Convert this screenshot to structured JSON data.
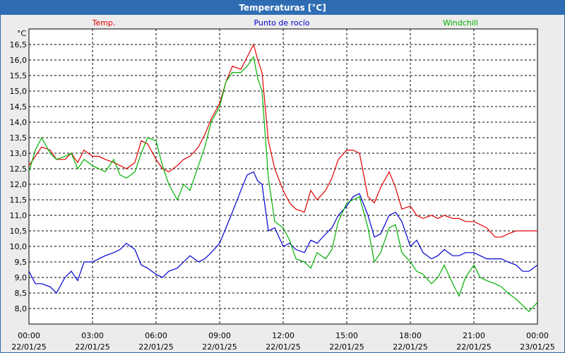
{
  "window": {
    "title": "Temperaturas [°C]"
  },
  "chart_data": {
    "type": "line",
    "title": "Temperaturas [°C]",
    "ylabel": "°C",
    "xlabel": "",
    "x_unit": "hours since 22/01/25 00:00",
    "ylim": [
      7.5,
      17.0
    ],
    "xlim": [
      0,
      24
    ],
    "grid": true,
    "legend_position": "top",
    "yticks": [
      "8,0",
      "8,5",
      "9,0",
      "9,5",
      "10,0",
      "10,5",
      "11,0",
      "11,5",
      "12,0",
      "12,5",
      "13,0",
      "13,5",
      "14,0",
      "14,5",
      "15,0",
      "15,5",
      "16,0",
      "16,5"
    ],
    "ytick_values": [
      8.0,
      8.5,
      9.0,
      9.5,
      10.0,
      10.5,
      11.0,
      11.5,
      12.0,
      12.5,
      13.0,
      13.5,
      14.0,
      14.5,
      15.0,
      15.5,
      16.0,
      16.5
    ],
    "xticks": [
      {
        "time": "00:00",
        "date": "22/01/25"
      },
      {
        "time": "03:00",
        "date": "22/01/25"
      },
      {
        "time": "06:00",
        "date": "22/01/25"
      },
      {
        "time": "09:00",
        "date": "22/01/25"
      },
      {
        "time": "12:00",
        "date": "22/01/25"
      },
      {
        "time": "15:00",
        "date": "22/01/25"
      },
      {
        "time": "18:00",
        "date": "22/01/25"
      },
      {
        "time": "21:00",
        "date": "22/01/25"
      },
      {
        "time": "00:00",
        "date": "23/01/25"
      }
    ],
    "xtick_values": [
      0,
      3,
      6,
      9,
      12,
      15,
      18,
      21,
      24
    ],
    "series": [
      {
        "name": "Temp.",
        "color": "#e00000",
        "x": [
          0,
          0.3,
          0.6,
          1.0,
          1.3,
          1.7,
          2.0,
          2.3,
          2.6,
          3.0,
          3.3,
          3.6,
          4.0,
          4.3,
          4.6,
          5.0,
          5.3,
          5.6,
          6.0,
          6.3,
          6.6,
          7.0,
          7.3,
          7.6,
          8.0,
          8.3,
          8.6,
          9.0,
          9.3,
          9.6,
          10.0,
          10.3,
          10.6,
          10.8,
          11.0,
          11.3,
          11.6,
          12.0,
          12.3,
          12.6,
          13.0,
          13.3,
          13.6,
          14.0,
          14.3,
          14.6,
          15.0,
          15.3,
          15.6,
          16.0,
          16.3,
          16.6,
          17.0,
          17.3,
          17.6,
          18.0,
          18.3,
          18.6,
          19.0,
          19.3,
          19.6,
          20.0,
          20.3,
          20.6,
          21.0,
          21.3,
          21.6,
          22.0,
          22.3,
          22.6,
          23.0,
          23.3,
          23.6,
          24.0
        ],
        "values": [
          12.6,
          12.9,
          13.2,
          13.1,
          12.8,
          12.8,
          13.0,
          12.7,
          13.1,
          12.9,
          12.9,
          12.8,
          12.7,
          12.6,
          12.5,
          12.7,
          13.4,
          13.3,
          12.8,
          12.5,
          12.4,
          12.6,
          12.8,
          12.9,
          13.2,
          13.6,
          14.1,
          14.6,
          15.3,
          15.8,
          15.7,
          16.1,
          16.5,
          16.0,
          15.6,
          13.4,
          12.5,
          11.8,
          11.4,
          11.2,
          11.1,
          11.8,
          11.5,
          11.8,
          12.2,
          12.8,
          13.1,
          13.1,
          13.0,
          11.6,
          11.4,
          11.9,
          12.4,
          11.9,
          11.2,
          11.3,
          11.0,
          10.9,
          11.0,
          10.9,
          11.0,
          10.9,
          10.9,
          10.8,
          10.8,
          10.7,
          10.6,
          10.3,
          10.3,
          10.4,
          10.5,
          10.5,
          10.5,
          10.5
        ]
      },
      {
        "name": "Punto de rocío",
        "color": "#0000d0",
        "x": [
          0,
          0.3,
          0.6,
          1.0,
          1.3,
          1.7,
          2.0,
          2.3,
          2.6,
          3.0,
          3.3,
          3.6,
          4.0,
          4.3,
          4.6,
          5.0,
          5.3,
          5.6,
          6.0,
          6.3,
          6.6,
          7.0,
          7.3,
          7.6,
          8.0,
          8.3,
          8.6,
          9.0,
          9.3,
          9.6,
          10.0,
          10.3,
          10.6,
          10.8,
          11.0,
          11.3,
          11.6,
          12.0,
          12.3,
          12.6,
          13.0,
          13.3,
          13.6,
          14.0,
          14.3,
          14.6,
          15.0,
          15.3,
          15.6,
          16.0,
          16.3,
          16.6,
          17.0,
          17.3,
          17.6,
          18.0,
          18.3,
          18.6,
          19.0,
          19.3,
          19.6,
          20.0,
          20.3,
          20.6,
          21.0,
          21.3,
          21.6,
          22.0,
          22.3,
          22.6,
          23.0,
          23.3,
          23.6,
          24.0
        ],
        "values": [
          9.2,
          8.8,
          8.8,
          8.7,
          8.5,
          9.0,
          9.2,
          8.9,
          9.5,
          9.5,
          9.6,
          9.7,
          9.8,
          9.9,
          10.1,
          9.9,
          9.4,
          9.3,
          9.1,
          9.0,
          9.2,
          9.3,
          9.5,
          9.7,
          9.5,
          9.6,
          9.8,
          10.1,
          10.6,
          11.1,
          11.8,
          12.3,
          12.4,
          12.1,
          12.0,
          10.5,
          10.6,
          10.0,
          10.1,
          9.9,
          9.8,
          10.2,
          10.1,
          10.4,
          10.6,
          11.0,
          11.3,
          11.6,
          11.7,
          11.0,
          10.3,
          10.4,
          11.0,
          11.1,
          10.8,
          10.0,
          10.2,
          9.8,
          9.6,
          9.7,
          9.9,
          9.7,
          9.7,
          9.8,
          9.8,
          9.7,
          9.6,
          9.6,
          9.6,
          9.5,
          9.4,
          9.2,
          9.2,
          9.4
        ]
      },
      {
        "name": "Windchill",
        "color": "#00b000",
        "x": [
          0,
          0.3,
          0.6,
          1.0,
          1.3,
          1.7,
          2.0,
          2.3,
          2.6,
          3.0,
          3.3,
          3.6,
          4.0,
          4.3,
          4.6,
          5.0,
          5.3,
          5.6,
          6.0,
          6.3,
          6.6,
          7.0,
          7.3,
          7.6,
          8.0,
          8.3,
          8.6,
          9.0,
          9.3,
          9.6,
          10.0,
          10.3,
          10.6,
          10.8,
          11.0,
          11.3,
          11.6,
          12.0,
          12.3,
          12.6,
          13.0,
          13.3,
          13.6,
          14.0,
          14.3,
          14.6,
          15.0,
          15.3,
          15.6,
          16.0,
          16.3,
          16.6,
          17.0,
          17.3,
          17.6,
          18.0,
          18.3,
          18.6,
          19.0,
          19.3,
          19.6,
          20.0,
          20.3,
          20.6,
          21.0,
          21.3,
          21.6,
          22.0,
          22.3,
          22.6,
          23.0,
          23.3,
          23.6,
          24.0
        ],
        "values": [
          12.4,
          13.1,
          13.5,
          13.0,
          12.8,
          12.9,
          13.0,
          12.5,
          12.8,
          12.6,
          12.5,
          12.4,
          12.8,
          12.3,
          12.2,
          12.4,
          13.0,
          13.5,
          13.4,
          12.6,
          12.0,
          11.5,
          12.0,
          11.8,
          12.6,
          13.2,
          14.0,
          14.5,
          15.3,
          15.6,
          15.6,
          15.8,
          16.1,
          15.4,
          15.0,
          12.2,
          10.8,
          10.6,
          10.2,
          9.6,
          9.5,
          9.3,
          9.8,
          9.6,
          9.9,
          10.8,
          11.4,
          11.5,
          11.6,
          10.6,
          9.5,
          9.8,
          10.6,
          10.7,
          9.8,
          9.5,
          9.2,
          9.1,
          8.8,
          9.0,
          9.4,
          8.8,
          8.4,
          9.0,
          9.4,
          9.0,
          8.9,
          8.8,
          8.7,
          8.5,
          8.3,
          8.1,
          7.9,
          8.2
        ]
      }
    ]
  }
}
